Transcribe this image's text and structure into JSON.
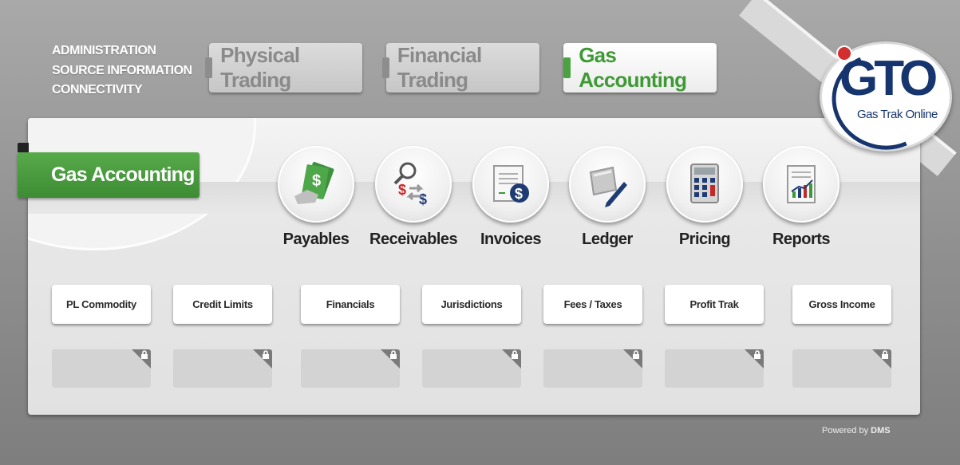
{
  "admin_links": [
    "ADMINISTRATION",
    "SOURCE INFORMATION",
    "CONNECTIVITY"
  ],
  "top_tabs": [
    {
      "label": "Physical Trading",
      "state": "inactive"
    },
    {
      "label": "Financial Trading",
      "state": "inactive"
    },
    {
      "label": "Gas Accounting",
      "state": "active"
    }
  ],
  "section_title": "Gas Accounting",
  "modules": [
    {
      "label": "Payables",
      "icon": "money-hand-icon"
    },
    {
      "label": "Receivables",
      "icon": "dollar-exchange-search-icon"
    },
    {
      "label": "Invoices",
      "icon": "invoice-dollar-icon"
    },
    {
      "label": "Ledger",
      "icon": "ledger-pen-icon"
    },
    {
      "label": "Pricing",
      "icon": "calculator-icon"
    },
    {
      "label": "Reports",
      "icon": "report-chart-icon"
    }
  ],
  "sub_buttons": [
    "PL Commodity",
    "Credit Limits",
    "Financials",
    "Jurisdictions",
    "Fees / Taxes",
    "Profit Trak",
    "Gross Income"
  ],
  "logo": {
    "text": "GTO",
    "subtitle": "Gas Trak Online"
  },
  "footer": {
    "powered_by": "Powered by",
    "brand": "DMS"
  },
  "colors": {
    "accent_green": "#3f9a35",
    "brand_navy": "#16356e",
    "brand_red": "#d32f2f"
  }
}
